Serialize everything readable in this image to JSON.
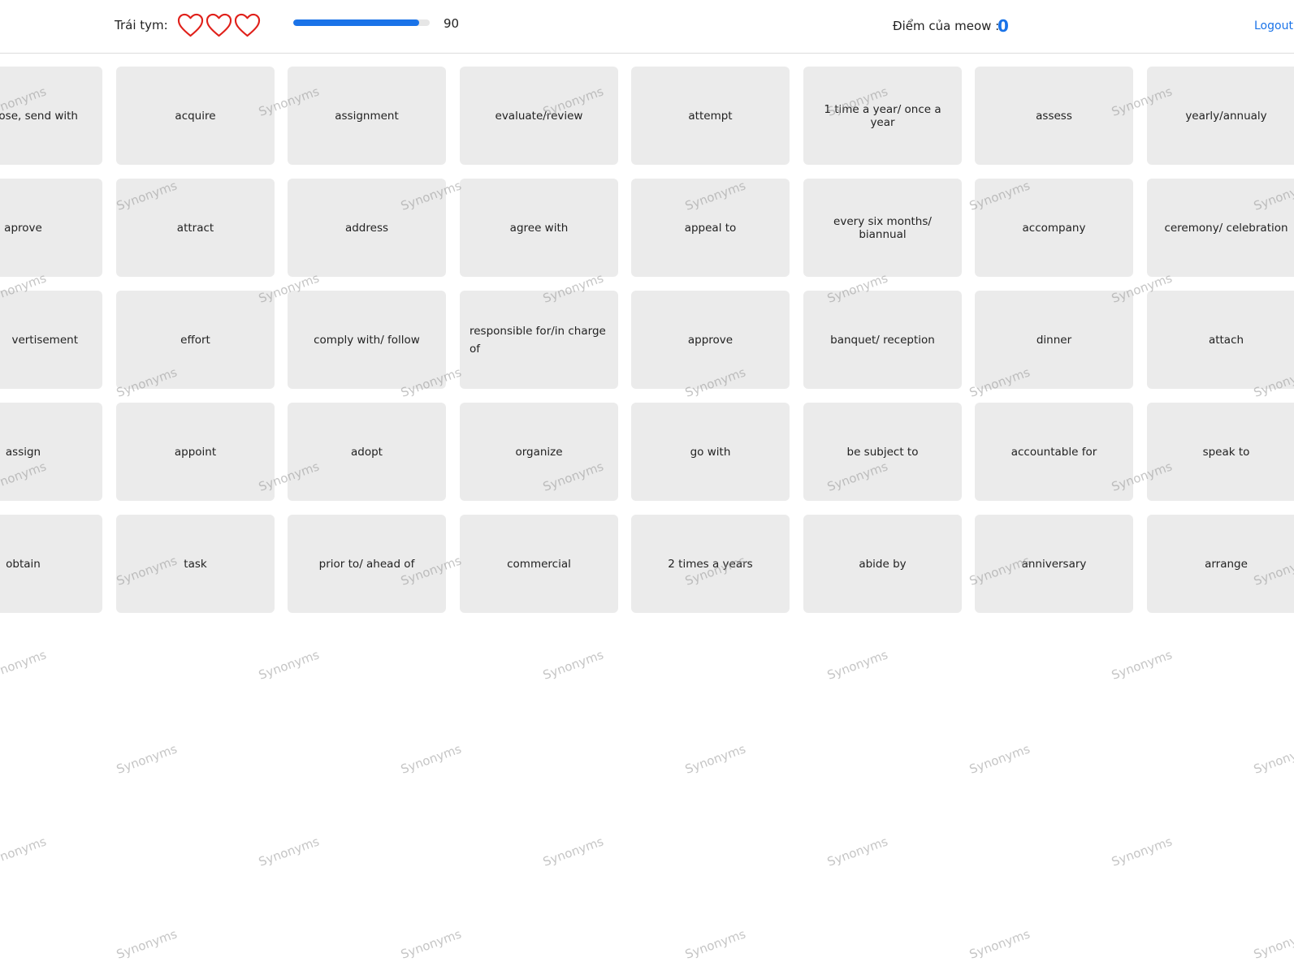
{
  "header": {
    "hearts_label": "Trái tym:",
    "hearts": [
      {
        "icon": "heart-outline-icon",
        "color": "#e0201a"
      },
      {
        "icon": "heart-outline-icon",
        "color": "#e0201a"
      },
      {
        "icon": "heart-outline-icon",
        "color": "#e0201a"
      }
    ],
    "timer_value": "90",
    "timer_progress": 0.92,
    "score_label": "Điểm của meow :",
    "score_value": "0",
    "logout_label": "Logout",
    "accent_color": "#1a73e8"
  },
  "watermark_text": "Synonyms",
  "cards": [
    [
      "enclose, send with",
      "acquire",
      "assignment",
      "evaluate/review",
      "attempt",
      "1 time a year/ once a year",
      "assess",
      "yearly/annualy"
    ],
    [
      "aprove",
      "attract",
      "address",
      "agree with",
      "appeal to",
      "every six months/ biannual",
      "accompany",
      "ceremony/ celebration"
    ],
    [
      "vertisement",
      "effort",
      "comply with/ follow",
      "responsible for/in charge of",
      "approve",
      "banquet/ reception",
      "dinner",
      "attach"
    ],
    [
      "assign",
      "appoint",
      "adopt",
      "organize",
      "go with",
      "be subject to",
      "accountable for",
      "speak to"
    ],
    [
      "obtain",
      "task",
      "prior to/ ahead of",
      "commercial",
      "2 times a years",
      "abide by",
      "anniversary",
      "arrange"
    ]
  ]
}
